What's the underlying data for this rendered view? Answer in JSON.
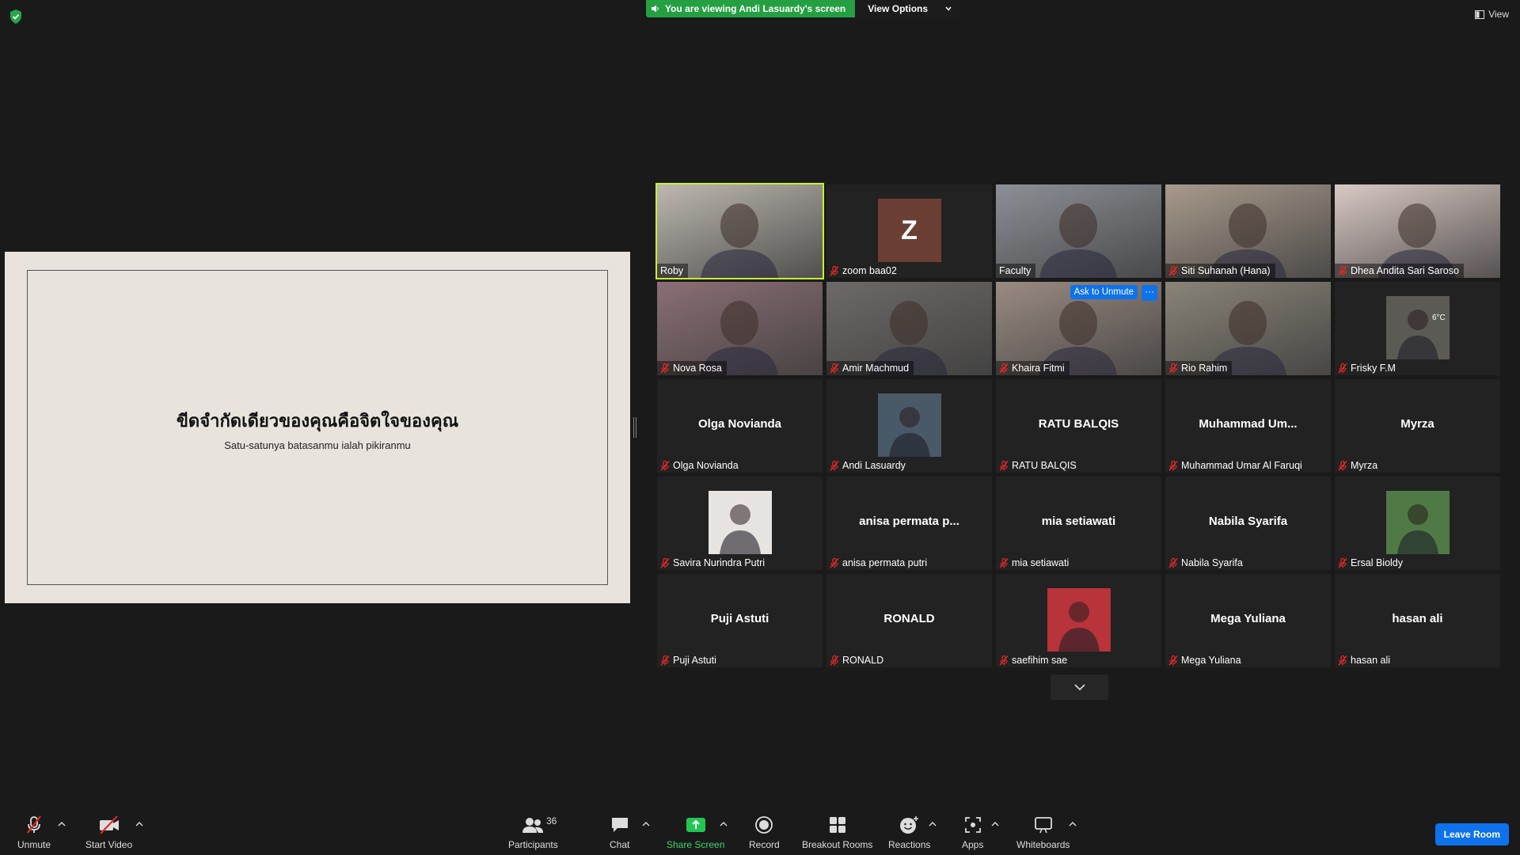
{
  "top": {
    "banner_text": "You are viewing Andi Lasuardy's screen",
    "view_options": "View Options",
    "view_label": "View"
  },
  "slide": {
    "title": "ขีดจำกัดเดียวของคุณคือจิตใจของคุณ",
    "subtitle": "Satu-satunya batasanmu ialah pikiranmu"
  },
  "tiles": [
    {
      "label": "Roby",
      "kind": "video",
      "muted": false,
      "active": true,
      "bg": "#bdb8b0"
    },
    {
      "label": "zoom baa02",
      "kind": "initial",
      "initial": "Z",
      "muted": true
    },
    {
      "label": "Faculty",
      "kind": "video",
      "muted": false,
      "bg": "#8c9096"
    },
    {
      "label": "Siti Suhanah (Hana)",
      "kind": "video",
      "muted": true,
      "bg": "#a89a8c"
    },
    {
      "label": "Dhea Andita Sari Saroso",
      "kind": "video",
      "muted": true,
      "bg": "#d9c9c4"
    },
    {
      "label": "Nova Rosa",
      "kind": "video",
      "muted": true,
      "bg": "#8a6f74"
    },
    {
      "label": "Amir Machmud",
      "kind": "video",
      "muted": true,
      "bg": "#6d6a68"
    },
    {
      "label": "Khaira Fitmi",
      "kind": "video",
      "muted": true,
      "bg": "#9a8b82",
      "hover": true
    },
    {
      "label": "Rio Rahim",
      "kind": "video",
      "muted": true,
      "bg": "#8a8478"
    },
    {
      "label": "Frisky F.M",
      "kind": "photo",
      "muted": true,
      "bg": "#5c5a55"
    },
    {
      "label": "Olga Novianda",
      "kind": "name",
      "big": "Olga Novianda",
      "muted": true
    },
    {
      "label": "Andi Lasuardy",
      "kind": "photo",
      "muted": true,
      "bg": "#4a5968"
    },
    {
      "label": "RATU BALQIS",
      "kind": "name",
      "big": "RATU BALQIS",
      "muted": true
    },
    {
      "label": "Muhammad Umar Al Faruqi",
      "kind": "name",
      "big": "Muhammad  Um...",
      "muted": true
    },
    {
      "label": "Myrza",
      "kind": "name",
      "big": "Myrza",
      "muted": true
    },
    {
      "label": "Savira Nurindra Putri",
      "kind": "photo",
      "muted": true,
      "bg": "#e8e4e2"
    },
    {
      "label": "anisa permata putri",
      "kind": "name",
      "big": "anisa  permata  p...",
      "muted": true
    },
    {
      "label": "mia setiawati",
      "kind": "name",
      "big": "mia setiawati",
      "muted": true
    },
    {
      "label": "Nabila Syarifa",
      "kind": "name",
      "big": "Nabila Syarifa",
      "muted": true
    },
    {
      "label": "Ersal Bioldy",
      "kind": "photo",
      "muted": true,
      "bg": "#4f7a45"
    },
    {
      "label": "Puji Astuti",
      "kind": "name",
      "big": "Puji Astuti",
      "muted": true
    },
    {
      "label": "RONALD",
      "kind": "name",
      "big": "RONALD",
      "muted": true
    },
    {
      "label": "saefihim sae",
      "kind": "photo",
      "muted": true,
      "bg": "#b8333a"
    },
    {
      "label": "Mega Yuliana",
      "kind": "name",
      "big": "Mega Yuliana",
      "muted": true
    },
    {
      "label": "hasan ali",
      "kind": "name",
      "big": "hasan ali",
      "muted": true
    }
  ],
  "hover_controls": {
    "ask_unmute": "Ask to Unmute",
    "more": "···"
  },
  "frisky_temp": "6°C",
  "toolbar": {
    "unmute": "Unmute",
    "start_video": "Start Video",
    "participants": "Participants",
    "participants_count": "36",
    "chat": "Chat",
    "share_screen": "Share Screen",
    "record": "Record",
    "breakout_rooms": "Breakout Rooms",
    "reactions": "Reactions",
    "apps": "Apps",
    "whiteboards": "Whiteboards",
    "leave_room": "Leave Room"
  },
  "colors": {
    "active_speaker": "#c7f02e",
    "share_green": "#24a043",
    "accent_blue": "#0e72ed",
    "muted_red": "#e02828"
  }
}
